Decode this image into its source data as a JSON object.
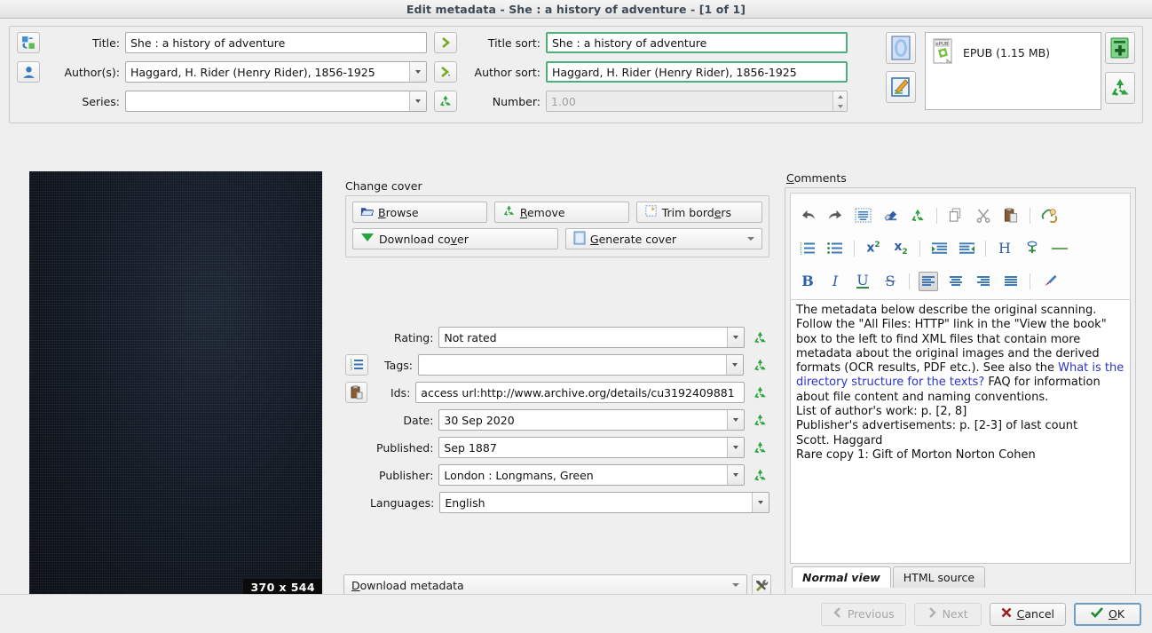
{
  "window": {
    "title": "Edit metadata - She : a history of adventure -  [1 of 1]"
  },
  "fields": {
    "title_label": "Title:",
    "title_value": "She : a history of adventure",
    "title_sort_label": "Title sort:",
    "title_sort_value": "She : a history of adventure",
    "authors_label": "Author(s):",
    "authors_value": "Haggard, H. Rider (Henry Rider), 1856-1925",
    "author_sort_label": "Author sort:",
    "author_sort_value": "Haggard, H. Rider (Henry Rider), 1856-1925",
    "series_label": "Series:",
    "series_value": "",
    "number_label": "Number:",
    "number_value": "1.00"
  },
  "formats": {
    "items": [
      {
        "name": "EPUB (1.15 MB)",
        "badge": "ePUB"
      }
    ]
  },
  "cover": {
    "dimensions": "370 x 544",
    "change_cover_label": "Change cover",
    "buttons": {
      "browse": "Browse",
      "remove": "Remove",
      "trim_borders": "Trim borders",
      "download_cover": "Download cover",
      "generate_cover": "Generate cover"
    }
  },
  "metadata": {
    "rating_label": "Rating:",
    "rating_value": "Not rated",
    "tags_label": "Tags:",
    "tags_value": "",
    "ids_label": "Ids:",
    "ids_value": "access url:http://www.archive.org/details/cu3192409881",
    "date_label": "Date:",
    "date_value": "30 Sep 2020",
    "published_label": "Published:",
    "published_value": "Sep 1887",
    "publisher_label": "Publisher:",
    "publisher_value": "London : Longmans, Green",
    "languages_label": "Languages:",
    "languages_value": "English",
    "download_metadata": "Download metadata"
  },
  "comments": {
    "label": "Comments",
    "body_paragraph": "The metadata below describe the original scanning. Follow the \"All Files: HTTP\" link in the \"View the book\" box to the left to find XML files that contain more metadata about the original images and the derived formats (OCR results, PDF etc.). See also the ",
    "link_text": "What is the directory structure for the texts?",
    "body_after_link": " FAQ for information about file content and naming conventions.",
    "line_2": "List of author's work: p. [2, 8]",
    "line_3": "Publisher's advertisements: p. [2-3] of last count",
    "line_4": "Scott. Haggard",
    "line_5": "Rare copy 1: Gift of Morton Norton Cohen",
    "tabs": [
      {
        "label": "Normal view",
        "active": true
      },
      {
        "label": "HTML source",
        "active": false
      }
    ]
  },
  "footer": {
    "previous": "Previous",
    "next": "Next",
    "cancel": "Cancel",
    "ok": "OK"
  },
  "colors": {
    "accent_green": "#4caf7d",
    "link_blue": "#2a35c8",
    "title_text": "#3d4a56",
    "window_bg": "#efefef"
  }
}
